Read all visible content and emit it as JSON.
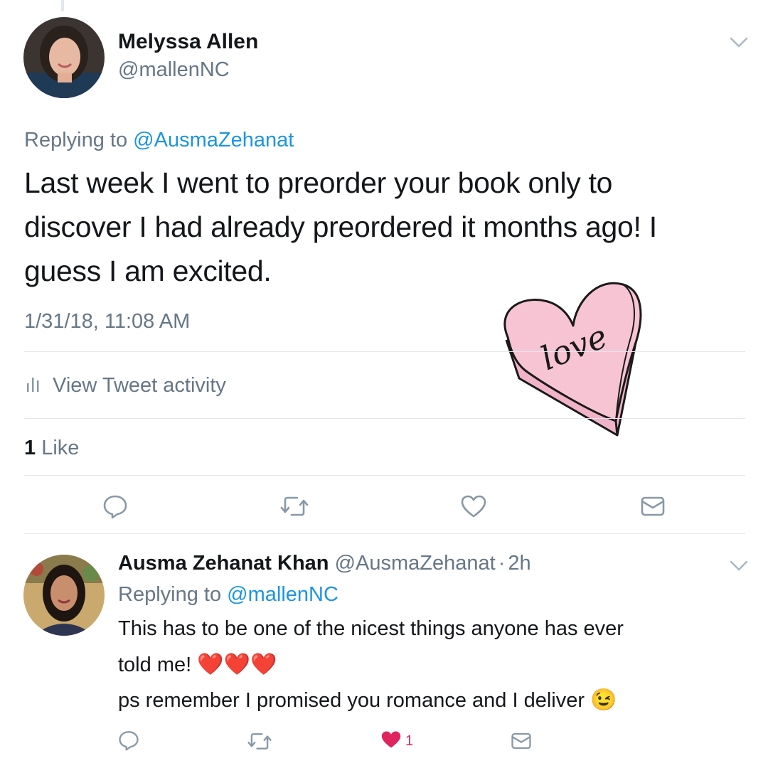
{
  "tweet": {
    "author_name": "Melyssa Allen",
    "author_handle": "@mallenNC",
    "replying_label": "Replying to",
    "replying_handle": "@AusmaZehanat",
    "text": "Last week I went to preorder your book only to discover I had already preordered it months ago! I guess I am excited.",
    "timestamp": "1/31/18, 11:08 AM",
    "activity_label": "View Tweet activity",
    "likes_count": "1",
    "likes_label": "Like"
  },
  "sticker": {
    "text": "love",
    "color": "#f7c4d4"
  },
  "reply": {
    "author_name": "Ausma Zehanat Khan",
    "author_handle": "@AusmaZehanat",
    "separator": "·",
    "time_ago": "2h",
    "replying_label": "Replying to",
    "replying_handle": "@mallenNC",
    "line1": "This has to be one of the nicest things anyone has ever",
    "line2": "told me!",
    "hearts": "❤️❤️❤️",
    "line3": "ps remember I promised you romance and I deliver",
    "wink": "😉",
    "like_count": "1"
  },
  "colors": {
    "link": "#1b95e0",
    "muted": "#657786",
    "icon": "#8899a6",
    "heart_active": "#e0245e",
    "divider": "#e1e8ed"
  }
}
